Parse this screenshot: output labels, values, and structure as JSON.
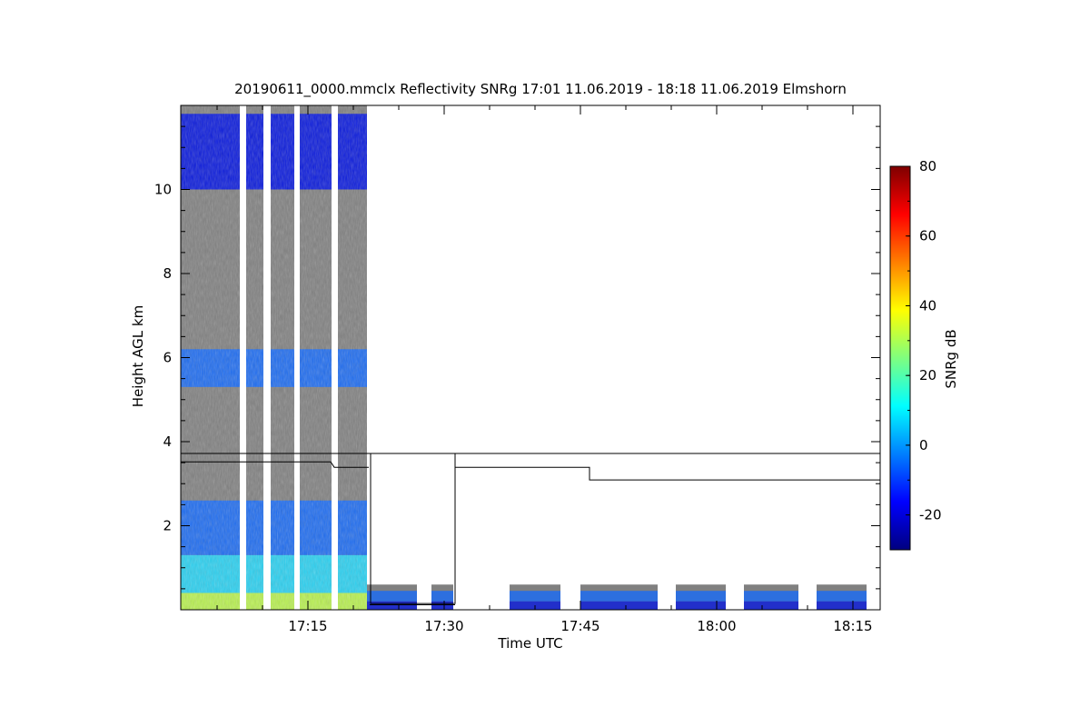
{
  "chart_data": {
    "type": "heatmap",
    "title": "20190611_0000.mmclx Reflectivity SNRg   17:01 11.06.2019 - 18:18 11.06.2019 Elmshorn",
    "xlabel": "Time UTC",
    "ylabel": "Height AGL km",
    "x_ticks": [
      {
        "label": "17:15",
        "t": 15
      },
      {
        "label": "17:30",
        "t": 30
      },
      {
        "label": "17:45",
        "t": 45
      },
      {
        "label": "18:00",
        "t": 60
      },
      {
        "label": "18:15",
        "t": 75
      }
    ],
    "y_ticks": [
      {
        "label": "2",
        "v": 2
      },
      {
        "label": "4",
        "v": 4
      },
      {
        "label": "6",
        "v": 6
      },
      {
        "label": "8",
        "v": 8
      },
      {
        "label": "10",
        "v": 10
      }
    ],
    "x_range_minutes_after_17": [
      1,
      78
    ],
    "y_range_km": [
      0,
      12
    ],
    "grid": false,
    "colorbar": {
      "label": "SNRg dB",
      "range": [
        -30,
        80
      ],
      "ticks": [
        {
          "label": "-20",
          "v": -20
        },
        {
          "label": "0",
          "v": 0
        },
        {
          "label": "20",
          "v": 20
        },
        {
          "label": "40",
          "v": 40
        },
        {
          "label": "60",
          "v": 60
        },
        {
          "label": "80",
          "v": 80
        }
      ],
      "colormap": [
        "#00007f",
        "#0000ff",
        "#007fff",
        "#00ffff",
        "#7fff7f",
        "#ffff00",
        "#ff7f00",
        "#ff0000",
        "#7f0000"
      ]
    },
    "colors": {
      "no_signal_gray": "#808080",
      "deep_blue": "#0a1adc",
      "mid_blue": "#1e6cf0",
      "cyan": "#2ad0f0",
      "green_yellow": "#b8f050"
    },
    "scan_periods": [
      [
        1,
        7.5
      ],
      [
        8.2,
        10.1
      ],
      [
        10.9,
        13.5
      ],
      [
        14.1,
        17.6
      ],
      [
        18.3,
        21.5
      ]
    ],
    "low_scan_periods": [
      [
        21.5,
        27.0
      ],
      [
        28.6,
        31.0
      ],
      [
        37.2,
        42.8
      ],
      [
        45.0,
        53.5
      ],
      [
        55.5,
        61.0
      ],
      [
        63.0,
        69.0
      ],
      [
        71.0,
        76.5
      ]
    ],
    "features": {
      "upper_cloud_km": [
        10.0,
        11.8
      ],
      "mid_layer_km": [
        5.3,
        6.2
      ],
      "boundary_layer_top_km": 2.6,
      "low_scan_top_km": 0.6
    },
    "lines": [
      {
        "points": [
          [
            1,
            3.72
          ],
          [
            31.2,
            3.72
          ],
          [
            31.2,
            0.15
          ],
          [
            21.9,
            0.15
          ],
          [
            21.9,
            3.72
          ],
          [
            18.3,
            3.72
          ]
        ],
        "segment": "upper"
      },
      {
        "points": [
          [
            31.2,
            3.72
          ],
          [
            78,
            3.72
          ]
        ],
        "segment": "upper-right"
      },
      {
        "points": [
          [
            31.2,
            3.39
          ],
          [
            46.0,
            3.39
          ],
          [
            46.0,
            3.09
          ],
          [
            78,
            3.09
          ]
        ],
        "segment": "lower-right"
      },
      {
        "points": [
          [
            1,
            3.52
          ],
          [
            17.5,
            3.52
          ],
          [
            17.9,
            3.39
          ],
          [
            21.7,
            3.39
          ]
        ],
        "segment": "lower-left"
      },
      {
        "points": [
          [
            21.8,
            0.12
          ],
          [
            31.2,
            0.12
          ]
        ],
        "segment": "bottom-step"
      }
    ]
  }
}
